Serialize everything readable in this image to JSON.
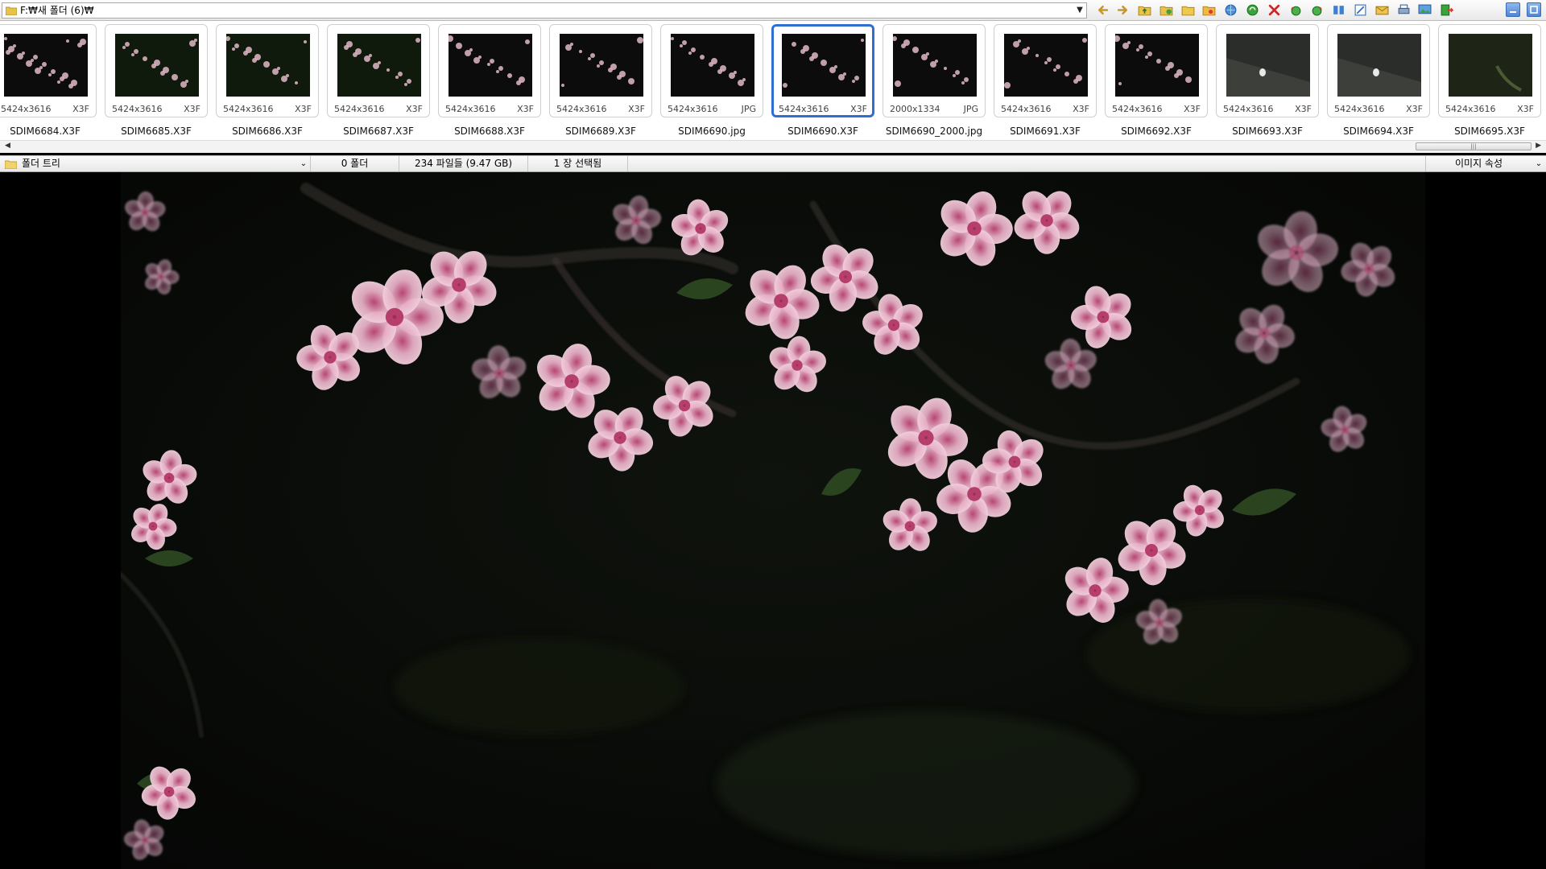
{
  "window": {
    "path": "F:₩새 폴더 (6)₩"
  },
  "toolbar": {
    "icons": [
      "arrow-left-icon",
      "arrow-right-icon",
      "folder-up-icon",
      "folder-new-icon",
      "folder-open-icon",
      "folder-star-icon",
      "search-globe-icon",
      "refresh-icon",
      "delete-x-icon",
      "rotate-left-icon",
      "rotate-right-icon",
      "compare-icon",
      "resize-icon",
      "email-icon",
      "print-icon",
      "wallpaper-icon",
      "exit-icon"
    ]
  },
  "thumbnails": [
    {
      "name": "SDIM6684.X3F",
      "dims": "5424x3616",
      "ext": "X3F",
      "selected": false
    },
    {
      "name": "SDIM6685.X3F",
      "dims": "5424x3616",
      "ext": "X3F",
      "selected": false
    },
    {
      "name": "SDIM6686.X3F",
      "dims": "5424x3616",
      "ext": "X3F",
      "selected": false
    },
    {
      "name": "SDIM6687.X3F",
      "dims": "5424x3616",
      "ext": "X3F",
      "selected": false
    },
    {
      "name": "SDIM6688.X3F",
      "dims": "5424x3616",
      "ext": "X3F",
      "selected": false
    },
    {
      "name": "SDIM6689.X3F",
      "dims": "5424x3616",
      "ext": "X3F",
      "selected": false
    },
    {
      "name": "SDIM6690.jpg",
      "dims": "5424x3616",
      "ext": "JPG",
      "selected": false
    },
    {
      "name": "SDIM6690.X3F",
      "dims": "5424x3616",
      "ext": "X3F",
      "selected": true
    },
    {
      "name": "SDIM6690_2000.jpg",
      "dims": "2000x1334",
      "ext": "JPG",
      "selected": false
    },
    {
      "name": "SDIM6691.X3F",
      "dims": "5424x3616",
      "ext": "X3F",
      "selected": false
    },
    {
      "name": "SDIM6692.X3F",
      "dims": "5424x3616",
      "ext": "X3F",
      "selected": false
    },
    {
      "name": "SDIM6693.X3F",
      "dims": "5424x3616",
      "ext": "X3F",
      "selected": false
    },
    {
      "name": "SDIM6694.X3F",
      "dims": "5424x3616",
      "ext": "X3F",
      "selected": false
    },
    {
      "name": "SDIM6695.X3F",
      "dims": "5424x3616",
      "ext": "X3F",
      "selected": false
    }
  ],
  "status": {
    "folder_tree": "폴더 트리",
    "folders": "0 폴더",
    "files": "234 파일들 (9.47 GB)",
    "selected": "1 장 선택됨",
    "properties": "이미지 속성"
  },
  "colors": {
    "selection": "#2f6fd2",
    "blossom": "#e9b6c8",
    "background": "#000000"
  }
}
